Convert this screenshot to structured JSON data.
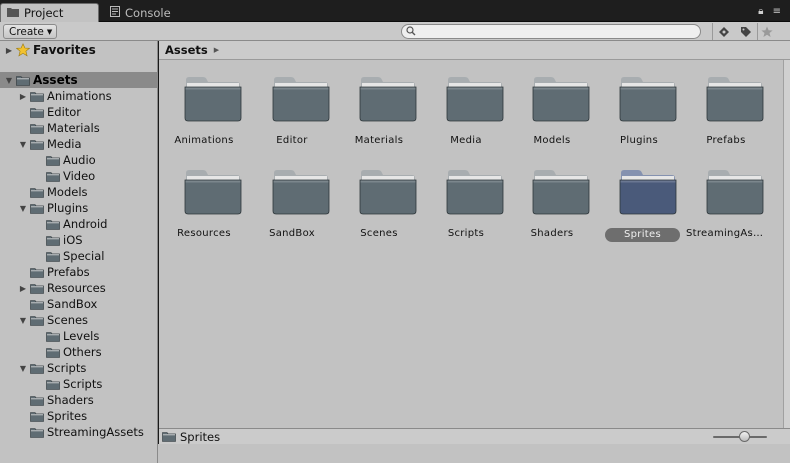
{
  "tabs": [
    {
      "label": "Project",
      "icon": "project-folder-icon",
      "active": true
    },
    {
      "label": "Console",
      "icon": "console-icon",
      "active": false
    }
  ],
  "toolbar": {
    "create_label": "Create",
    "search_placeholder": "",
    "icons": [
      "search-by-type-icon",
      "search-by-label-icon",
      "favorite-star-icon"
    ]
  },
  "tree": {
    "favorites_label": "Favorites",
    "assets_label": "Assets",
    "items": [
      {
        "label": "Animations",
        "depth": 1,
        "expander": "collapsed"
      },
      {
        "label": "Editor",
        "depth": 1,
        "expander": "none"
      },
      {
        "label": "Materials",
        "depth": 1,
        "expander": "none"
      },
      {
        "label": "Media",
        "depth": 1,
        "expander": "expanded"
      },
      {
        "label": "Audio",
        "depth": 2,
        "expander": "none"
      },
      {
        "label": "Video",
        "depth": 2,
        "expander": "none"
      },
      {
        "label": "Models",
        "depth": 1,
        "expander": "none"
      },
      {
        "label": "Plugins",
        "depth": 1,
        "expander": "expanded"
      },
      {
        "label": "Android",
        "depth": 2,
        "expander": "none"
      },
      {
        "label": "iOS",
        "depth": 2,
        "expander": "none"
      },
      {
        "label": "Special",
        "depth": 2,
        "expander": "none"
      },
      {
        "label": "Prefabs",
        "depth": 1,
        "expander": "none"
      },
      {
        "label": "Resources",
        "depth": 1,
        "expander": "collapsed"
      },
      {
        "label": "SandBox",
        "depth": 1,
        "expander": "none"
      },
      {
        "label": "Scenes",
        "depth": 1,
        "expander": "expanded"
      },
      {
        "label": "Levels",
        "depth": 2,
        "expander": "none"
      },
      {
        "label": "Others",
        "depth": 2,
        "expander": "none"
      },
      {
        "label": "Scripts",
        "depth": 1,
        "expander": "expanded"
      },
      {
        "label": "Scripts",
        "depth": 2,
        "expander": "none"
      },
      {
        "label": "Shaders",
        "depth": 1,
        "expander": "none"
      },
      {
        "label": "Sprites",
        "depth": 1,
        "expander": "none"
      },
      {
        "label": "StreamingAssets",
        "depth": 1,
        "expander": "none"
      }
    ]
  },
  "breadcrumb": {
    "label": "Assets"
  },
  "grid": {
    "items": [
      {
        "label": "Animations",
        "selected": false
      },
      {
        "label": "Editor",
        "selected": false
      },
      {
        "label": "Materials",
        "selected": false
      },
      {
        "label": "Media",
        "selected": false
      },
      {
        "label": "Models",
        "selected": false
      },
      {
        "label": "Plugins",
        "selected": false
      },
      {
        "label": "Prefabs",
        "selected": false
      },
      {
        "label": "Resources",
        "selected": false
      },
      {
        "label": "SandBox",
        "selected": false
      },
      {
        "label": "Scenes",
        "selected": false
      },
      {
        "label": "Scripts",
        "selected": false
      },
      {
        "label": "Shaders",
        "selected": false
      },
      {
        "label": "Sprites",
        "selected": true
      },
      {
        "label": "StreamingAssets",
        "selected": false
      }
    ]
  },
  "status": {
    "label": "Sprites",
    "icon": "folder-icon"
  },
  "colors": {
    "folder_body": "#5f6c73",
    "folder_tab": "#a8adb0",
    "folder_selected": "#4a5a7a",
    "panel_bg": "#c2c2c2",
    "selection_bg": "#8a8a8a"
  }
}
